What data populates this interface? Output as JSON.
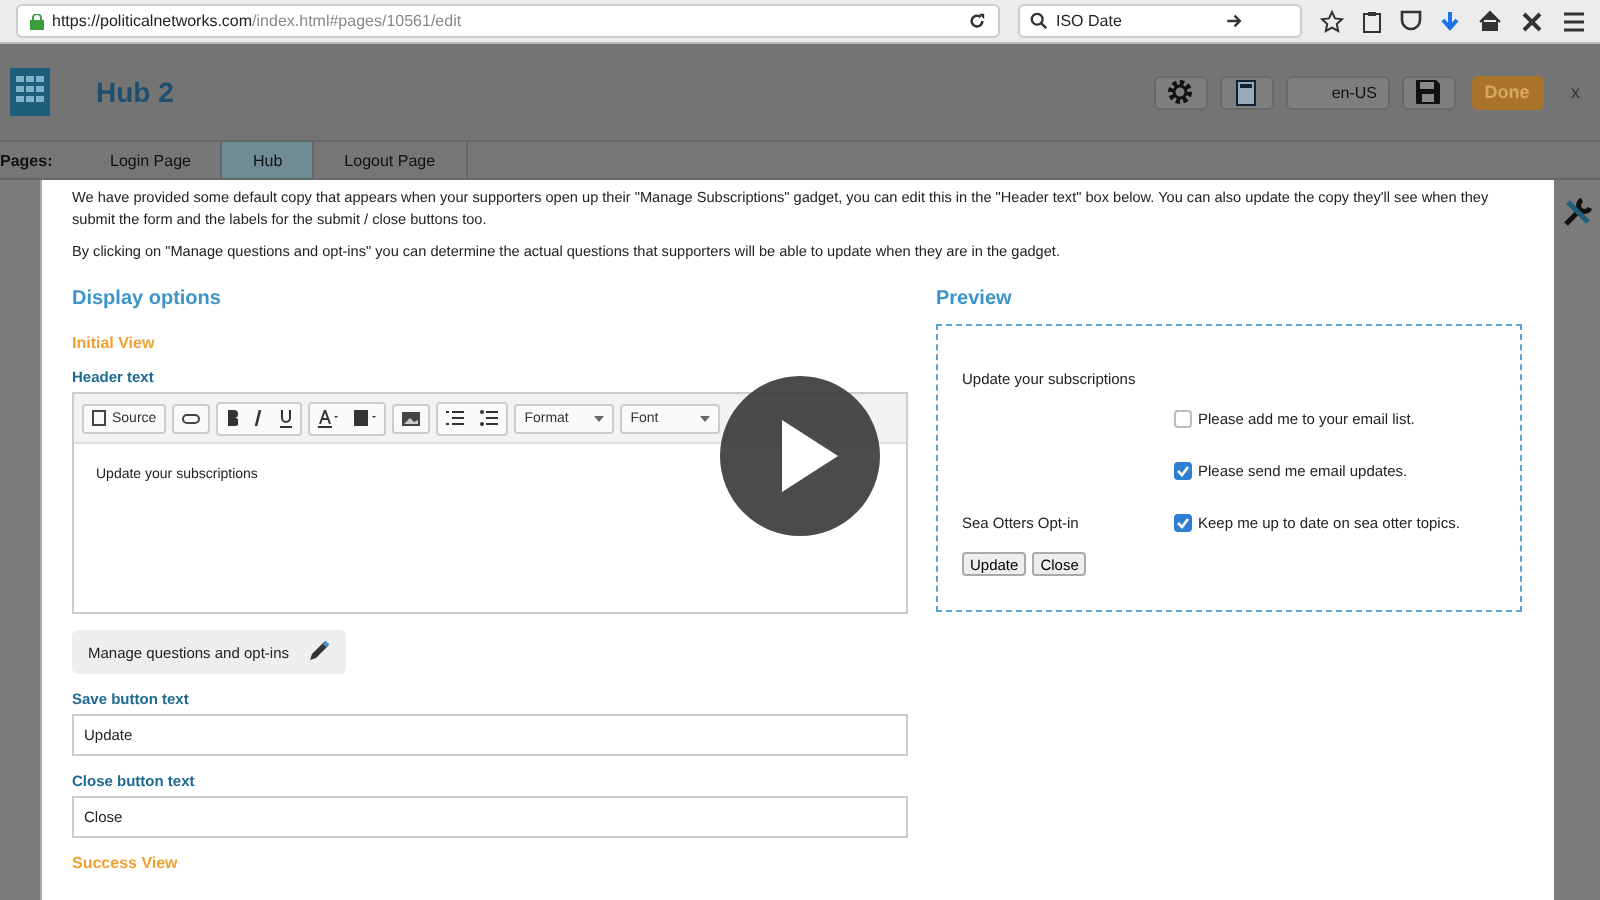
{
  "browser": {
    "url_host": "https://politicalnetworks.com",
    "url_path": "/index.html#pages/10561/edit",
    "search_value": "ISO Date"
  },
  "header": {
    "title": "Hub 2",
    "locale": "en-US",
    "done": "Done",
    "close": "x"
  },
  "pages": {
    "label": "Pages:",
    "tabs": [
      {
        "label": "Login Page",
        "selected": false
      },
      {
        "label": "Hub",
        "selected": true
      },
      {
        "label": "Logout Page",
        "selected": false
      }
    ]
  },
  "intro": [
    "We have provided some default copy that appears when your supporters open up their \"Manage Subscriptions\" gadget, you can edit this in the \"Header text\" box below. You can also update the copy they'll see when they submit the form and the labels for the submit / close buttons too.",
    "By clicking on \"Manage questions and opt-ins\" you can determine the actual questions that supporters will be able to update when they are in the gadget."
  ],
  "display_options": {
    "title": "Display options",
    "initial_view": "Initial View",
    "header_label": "Header text",
    "toolbar": {
      "source": "Source",
      "format": "Format",
      "font": "Font"
    },
    "editor_text": "Update your subscriptions",
    "manage_button": "Manage questions and opt-ins",
    "save_label": "Save button text",
    "save_value": "Update",
    "close_label": "Close button text",
    "close_value": "Close",
    "success_view": "Success View"
  },
  "preview": {
    "title": "Preview",
    "heading": "Update your subscriptions",
    "rows": [
      {
        "label": "",
        "text": "Please add me to your email list.",
        "checked": false
      },
      {
        "label": "",
        "text": "Please send me email updates.",
        "checked": true
      },
      {
        "label": "Sea Otters Opt-in",
        "text": "Keep me up to date on sea otter topics.",
        "checked": true
      }
    ],
    "buttons": [
      "Update",
      "Close"
    ]
  }
}
